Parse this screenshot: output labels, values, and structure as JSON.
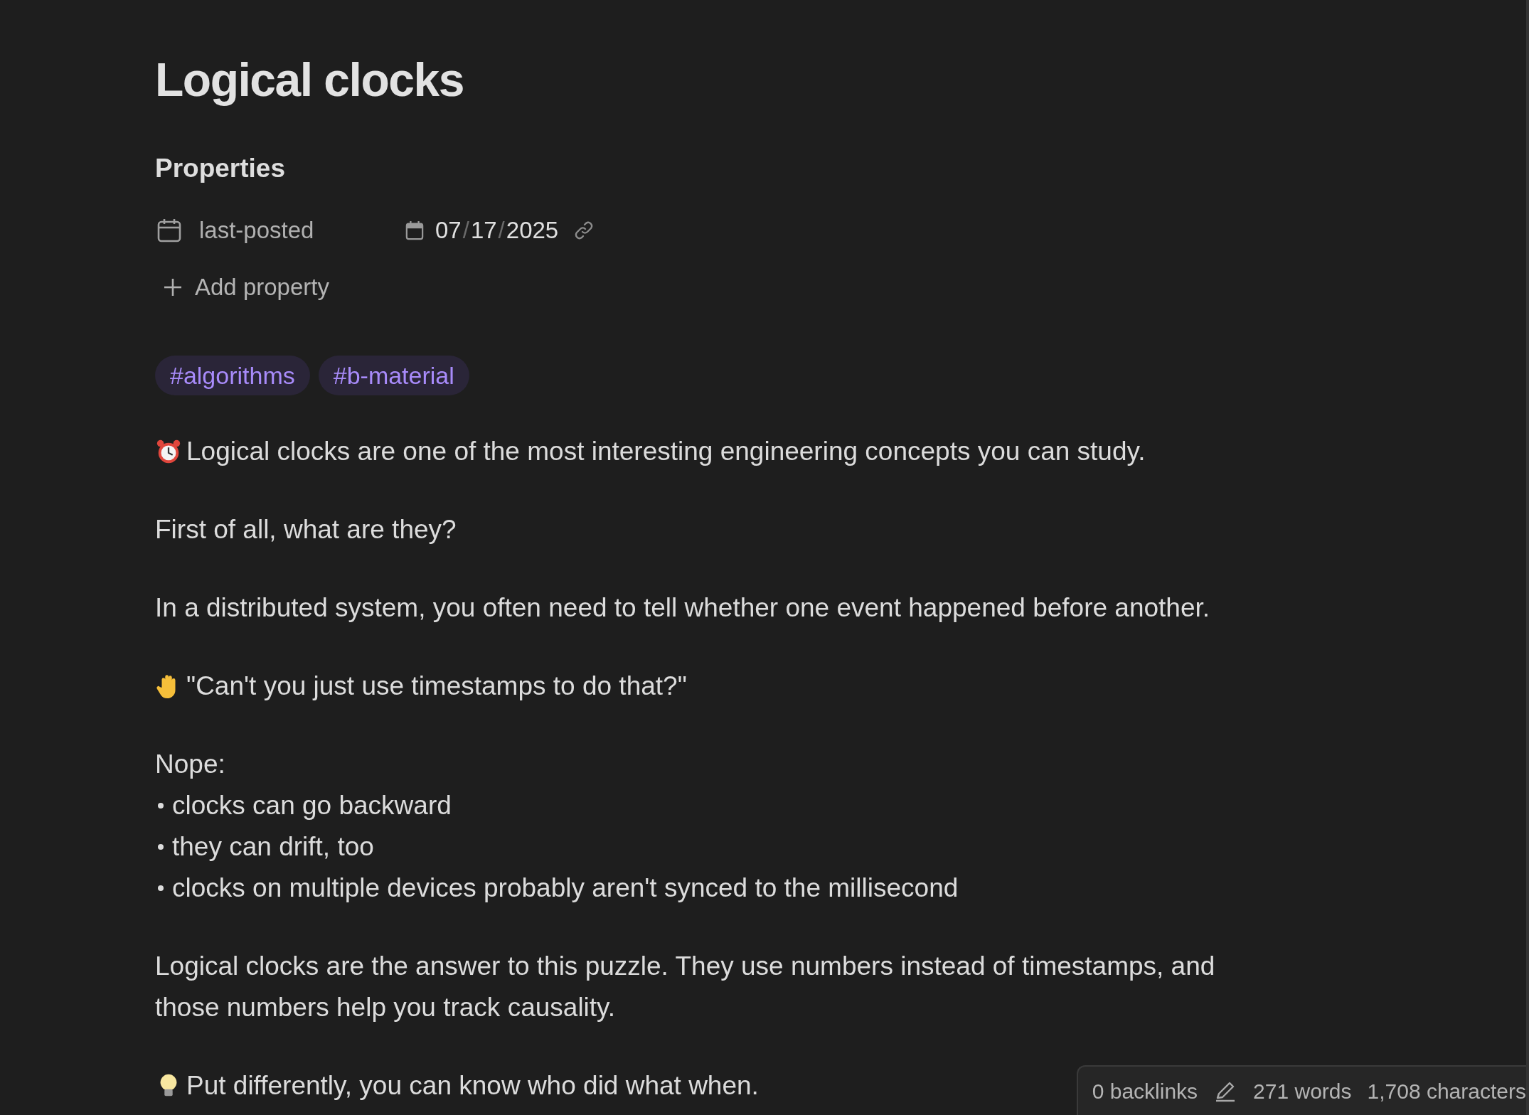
{
  "note": {
    "title": "Logical clocks"
  },
  "properties": {
    "heading": "Properties",
    "items": [
      {
        "name": "last-posted",
        "kind": "date",
        "date_parts": [
          "07",
          "17",
          "2025"
        ],
        "separator": "/"
      }
    ],
    "add_label": "Add property"
  },
  "tags": [
    "#algorithms",
    "#b-material"
  ],
  "blocks": [
    {
      "kind": "alarm",
      "text": "Logical clocks are one of the most interesting engineering concepts you can study."
    },
    {
      "kind": "text",
      "text": "First of all, what are they?"
    },
    {
      "kind": "text",
      "text": "In a distributed system, you often need to tell whether one event happened before another."
    },
    {
      "kind": "hand",
      "text": "\"Can't you just use timestamps to do that?\""
    },
    {
      "kind": "list",
      "lead": "Nope:",
      "items": [
        "clocks can go backward",
        "they can drift, too",
        "clocks on multiple devices probably aren't synced to the millisecond"
      ]
    },
    {
      "kind": "text",
      "text": "Logical clocks are the answer to this puzzle. They use numbers instead of timestamps, and those numbers help you track causality."
    },
    {
      "kind": "bulb",
      "text": "Put differently, you can know who did what when."
    }
  ],
  "status_bar": {
    "backlinks": "0 backlinks",
    "words": "271 words",
    "characters": "1,708 characters"
  }
}
